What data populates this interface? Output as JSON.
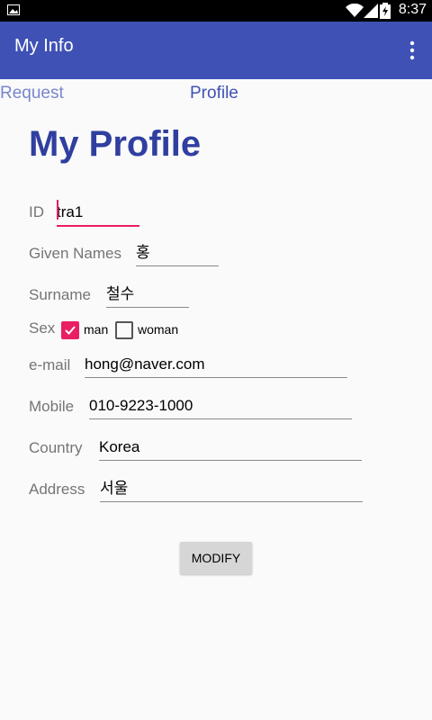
{
  "status_bar": {
    "time": "8:37",
    "icons": [
      "image-icon",
      "wifi-icon",
      "signal-icon",
      "battery-charging-icon"
    ]
  },
  "app_bar": {
    "title": "My Info",
    "overflow_icon": "more-vert-icon",
    "color": "#3f51b5"
  },
  "tabs": [
    {
      "label": "Request",
      "selected": false
    },
    {
      "label": "Profile",
      "selected": true
    }
  ],
  "page": {
    "title": "My Profile"
  },
  "form": {
    "id": {
      "label": "ID",
      "value": "tra1"
    },
    "given_names": {
      "label": "Given Names",
      "value": "홍"
    },
    "surname": {
      "label": "Surname",
      "value": "철수"
    },
    "sex": {
      "label": "Sex",
      "options": [
        {
          "label": "man",
          "checked": true
        },
        {
          "label": "woman",
          "checked": false
        }
      ]
    },
    "email": {
      "label": "e-mail",
      "value": "hong@naver.com"
    },
    "mobile": {
      "label": "Mobile",
      "value": "010-9223-1000"
    },
    "country": {
      "label": "Country",
      "value": "Korea"
    },
    "address": {
      "label": "Address",
      "value": "서울"
    }
  },
  "actions": {
    "modify_label": "MODIFY"
  },
  "colors": {
    "accent": "#e91e63",
    "title": "#303f9f"
  }
}
